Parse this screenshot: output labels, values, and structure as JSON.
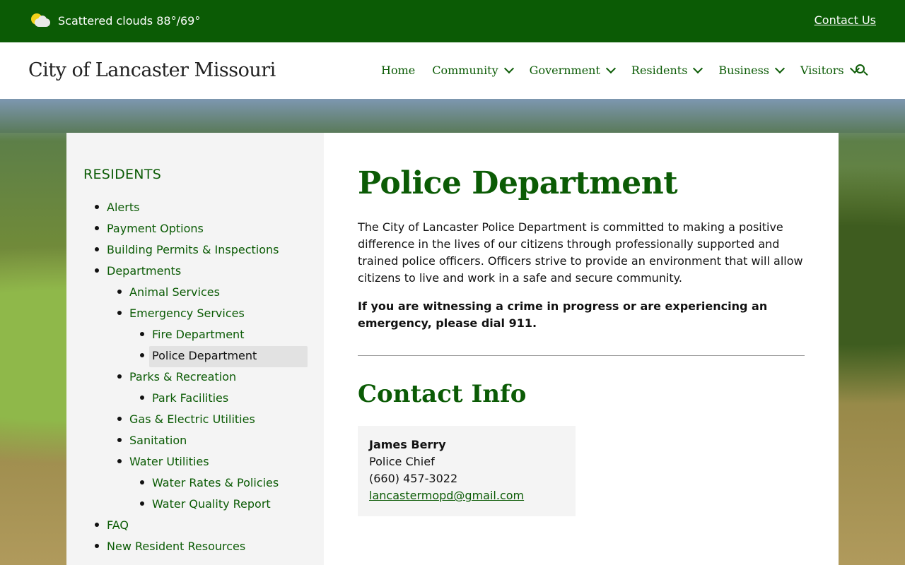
{
  "topbar": {
    "weather_text": "Scattered clouds 88°/69°",
    "contact_link": "Contact Us"
  },
  "header": {
    "site_title": "City of Lancaster Missouri",
    "nav": [
      {
        "label": "Home",
        "has_dropdown": false
      },
      {
        "label": "Community",
        "has_dropdown": true
      },
      {
        "label": "Government",
        "has_dropdown": true
      },
      {
        "label": "Residents",
        "has_dropdown": true
      },
      {
        "label": "Business",
        "has_dropdown": true
      },
      {
        "label": "Visitors",
        "has_dropdown": true
      }
    ]
  },
  "sidebar": {
    "heading": "RESIDENTS",
    "items": [
      {
        "label": "Alerts",
        "level": 0
      },
      {
        "label": "Payment Options",
        "level": 0
      },
      {
        "label": "Building Permits & Inspections",
        "level": 0
      },
      {
        "label": "Departments",
        "level": 0
      },
      {
        "label": "Animal Services",
        "level": 1
      },
      {
        "label": "Emergency Services",
        "level": 1
      },
      {
        "label": "Fire Department",
        "level": 2
      },
      {
        "label": "Police Department",
        "level": 2,
        "active": true
      },
      {
        "label": "Parks & Recreation",
        "level": 1
      },
      {
        "label": "Park Facilities",
        "level": 2
      },
      {
        "label": "Gas & Electric Utilities",
        "level": 1
      },
      {
        "label": "Sanitation",
        "level": 1
      },
      {
        "label": "Water Utilities",
        "level": 1
      },
      {
        "label": "Water Rates & Policies",
        "level": 2
      },
      {
        "label": "Water Quality Report",
        "level": 2
      },
      {
        "label": "FAQ",
        "level": 0
      },
      {
        "label": "New Resident Resources",
        "level": 0
      }
    ]
  },
  "main": {
    "title": "Police Department",
    "intro": "The City of Lancaster Police Department is committed to making a positive difference in the lives of our citizens through professionally supported and trained police officers. Officers strive to provide an environment that will allow citizens to live and work in a safe and secure community.",
    "emergency": "If you are witnessing a crime in progress or are experiencing an emergency, please dial 911.",
    "contact_heading": "Contact Info",
    "contact": {
      "name": "James Berry",
      "role": "Police Chief",
      "phone": "(660) 457-3022",
      "email": "lancastermopd@gmail.com"
    }
  },
  "colors": {
    "brand_green": "#0b5b05",
    "sidebar_bg": "#f4f4f4"
  }
}
